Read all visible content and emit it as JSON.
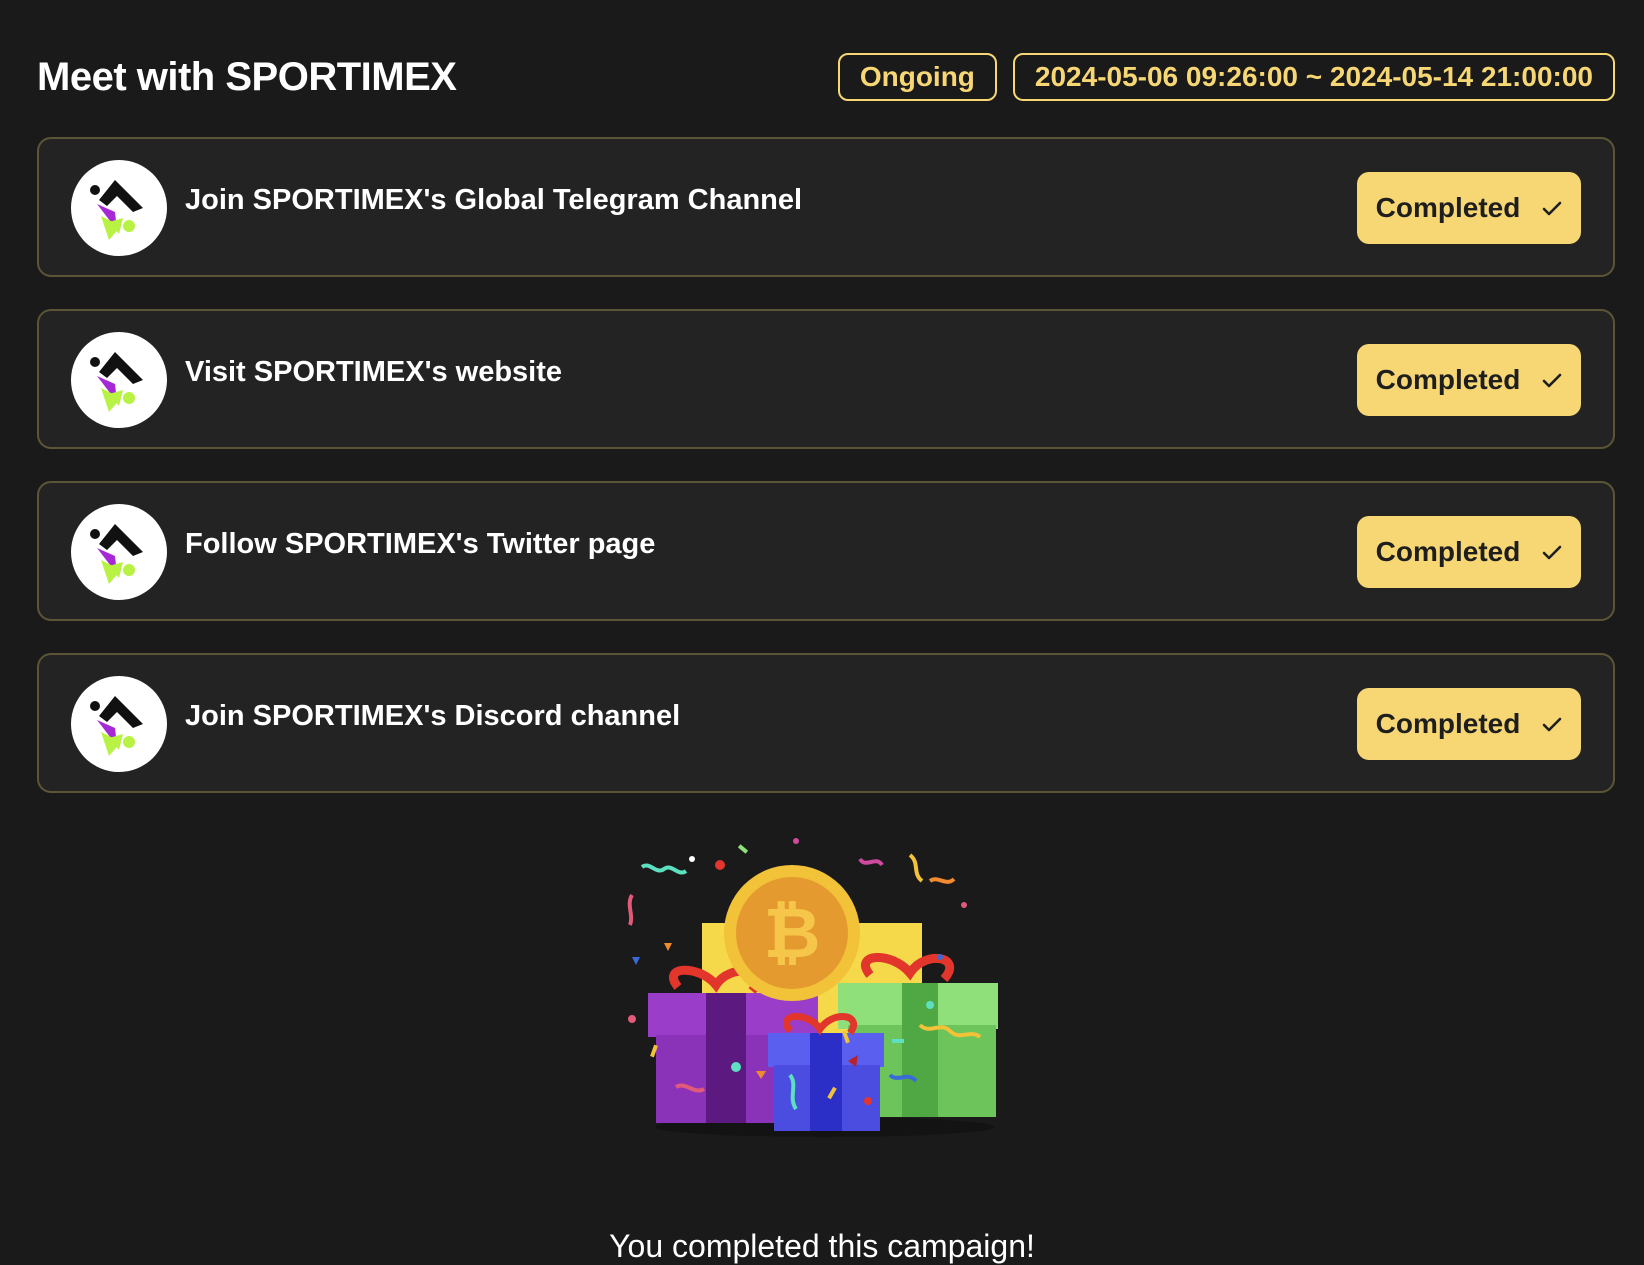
{
  "page": {
    "title": "Meet with SPORTIMEX",
    "status_badge": "Ongoing",
    "date_range": "2024-05-06 09:26:00 ~ 2024-05-14 21:00:00"
  },
  "tasks": [
    {
      "label": "Join SPORTIMEX's Global Telegram Channel",
      "button": "Completed"
    },
    {
      "label": "Visit SPORTIMEX's website",
      "button": "Completed"
    },
    {
      "label": "Follow SPORTIMEX's Twitter page",
      "button": "Completed"
    },
    {
      "label": "Join SPORTIMEX's Discord channel",
      "button": "Completed"
    }
  ],
  "completion": {
    "message": "You completed this campaign!"
  },
  "icons": {
    "task_logo": "sportimex-logo-icon",
    "button_check": "check-icon",
    "illustration": "gift-boxes-bitcoin-illustration"
  },
  "colors": {
    "background": "#1a1a1a",
    "card_background": "#232323",
    "card_border": "#5c5535",
    "accent": "#f7d774",
    "text": "#ffffff",
    "button_text": "#1e1e1e"
  }
}
